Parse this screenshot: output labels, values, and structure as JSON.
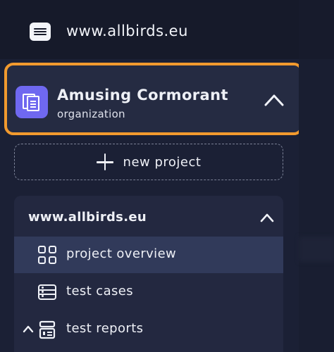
{
  "site": {
    "title": "www.allbirds.eu",
    "icon": "server-icon"
  },
  "organization": {
    "name": "Amusing Cormorant",
    "type": "organization",
    "icon": "organization-icon",
    "highlight_color": "#f29a2e",
    "avatar_color": "#6f68f0"
  },
  "new_project": {
    "label": "new project",
    "icon": "plus-icon"
  },
  "project": {
    "title": "www.allbirds.eu",
    "items": [
      {
        "label": "project overview",
        "icon": "grid-icon",
        "active": true
      },
      {
        "label": "test cases",
        "icon": "test-cases-icon",
        "active": false
      },
      {
        "label": "test reports",
        "icon": "test-reports-icon",
        "active": false
      }
    ]
  }
}
